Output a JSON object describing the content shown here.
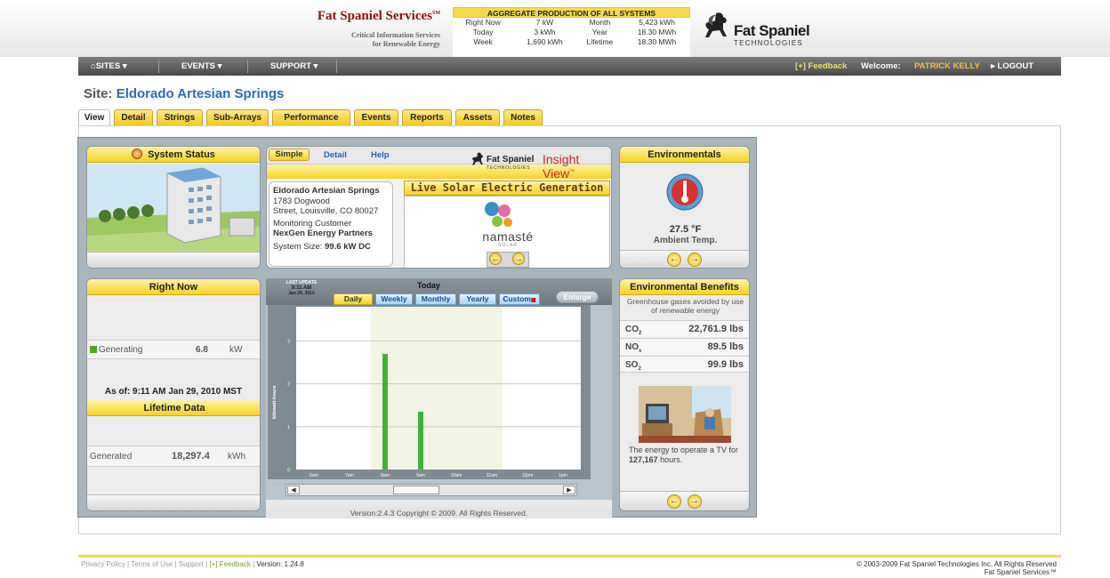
{
  "header": {
    "brand_name": "Fat Spaniel Services",
    "brand_sup": "SM",
    "brand_tag_1": "Critical Information Services",
    "brand_tag_2": "for Renewable Energy",
    "logo_main": "Fat Spaniel",
    "logo_sub": "TECHNOLOGIES"
  },
  "aggregate": {
    "title": "AGGREGATE PRODUCTION OF ALL SYSTEMS",
    "rows": [
      {
        "label": "Right Now",
        "value": "7 kW",
        "label2": "Month",
        "value2": "5,423 kWh"
      },
      {
        "label": "Today",
        "value": "3 kWh",
        "label2": "Year",
        "value2": "18.30 MWh"
      },
      {
        "label": "Week",
        "value": "1,690 kWh",
        "label2": "Lifetime",
        "value2": "18.30 MWh"
      }
    ]
  },
  "nav": {
    "sites": "SITES ▾",
    "events": "EVENTS ▾",
    "support": "SUPPORT ▾",
    "feedback": "[+] Feedback",
    "welcome": "Welcome:",
    "user": "PATRICK KELLY",
    "logout": "▸ LOGOUT"
  },
  "site": {
    "prefix": "Site:",
    "name": "Eldorado Artesian Springs"
  },
  "tabs": [
    "View",
    "Detail",
    "Strings",
    "Sub-Arrays",
    "Performance",
    "Events",
    "Reports",
    "Assets",
    "Notes"
  ],
  "system_status": {
    "title": "System Status"
  },
  "insight": {
    "subtabs": [
      "Simple",
      "Detail",
      "Help"
    ],
    "brand": "Fat Spaniel",
    "brand_sub": "TECHNOLOGIES",
    "product": "Insight View",
    "product_tm": "™",
    "live_title": "Live Solar Electric Generation",
    "site_name": "Eldorado Artesian Springs",
    "address_1": "1783 Dogwood",
    "address_2": "Street, Louisville, CO 80027",
    "monitoring_label": "Monitoring Customer",
    "customer": "NexGen Energy Partners",
    "size_label": "System Size:",
    "size_value": "99.6 kW DC",
    "partner_logo_text": "namasté",
    "partner_logo_sub": "SOLAR"
  },
  "environmentals": {
    "title": "Environmentals",
    "temp": "27.5 °F",
    "temp_label": "Ambient Temp."
  },
  "right_now": {
    "title": "Right Now",
    "status": "Generating",
    "value": "6.8",
    "unit": "kW",
    "as_of": "As of: 9:11 AM Jan 29, 2010 MST",
    "lifetime_title": "Lifetime Data",
    "gen_label": "Generated",
    "gen_value": "18,297.4",
    "gen_unit": "kWh"
  },
  "chart_panel": {
    "last_update_label": "LAST UPDATE",
    "last_update_time": "9:11 AM",
    "last_update_date": "Jan 29, 2010",
    "heading": "Today",
    "tabs": [
      "Daily",
      "Weekly",
      "Monthly",
      "Yearly",
      "Custom"
    ],
    "enlarge": "Enlarge",
    "version": "Version:2.4.3   Copyright © 2009. All Rights Reserved."
  },
  "chart_data": {
    "type": "bar",
    "categories": [
      "6am",
      "7am",
      "8am",
      "9am",
      "10am",
      "11am",
      "12pm",
      "1pm"
    ],
    "values": [
      0,
      0,
      2.7,
      1.35,
      0,
      0,
      0,
      0
    ],
    "ylabel": "kilowatt-hours",
    "yticks": [
      "0",
      "1",
      "2",
      "3"
    ],
    "ylim": [
      0,
      3.8
    ],
    "bar_color": "#3cb43c"
  },
  "env_benefits": {
    "title": "Environmental Benefits",
    "desc": "Greenhouse gases avoided by use of renewable energy",
    "rows": [
      {
        "gas": "CO",
        "sub": "2",
        "value": "22,761.9 lbs"
      },
      {
        "gas": "NO",
        "sub": "x",
        "value": "89.5 lbs"
      },
      {
        "gas": "SO",
        "sub": "2",
        "value": "99.9 lbs"
      }
    ],
    "tv_text_1": "The energy to operate a TV for",
    "tv_hours": "127,167",
    "tv_text_2": "hours."
  },
  "footer": {
    "privacy": "Privacy Policy",
    "terms": "Terms of Use",
    "support": "Support",
    "feedback": "[+] Feedback",
    "version": "Version: 1.24.8",
    "copyright": "© 2003-2009  Fat Spaniel Technologies Inc. All Rights Reserved",
    "copyright_2": "Fat Spaniel Services™"
  }
}
